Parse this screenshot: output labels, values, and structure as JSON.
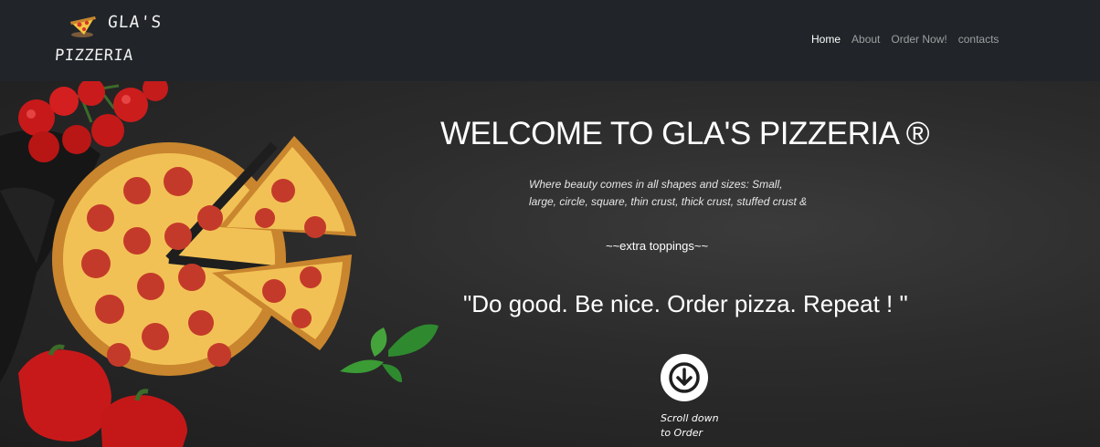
{
  "header": {
    "brand_line1": "GLA'S",
    "brand_line2": "PIZZERIA",
    "nav": [
      {
        "label": "Home",
        "active": true
      },
      {
        "label": "About"
      },
      {
        "label": "Order Now!"
      },
      {
        "label": "contacts"
      }
    ]
  },
  "hero": {
    "title": "WELCOME TO GLA'S PIZZERIA ®",
    "tagline_line1": "Where beauty comes in all shapes and sizes: Small,",
    "tagline_line2": "large, circle, square, thin crust, thick crust, stuffed crust &",
    "extra": "~~extra toppings~~",
    "quote": "\"Do good. Be nice. Order pizza. Repeat ! \"",
    "scroll_line1": "Scroll down",
    "scroll_line2": "to Order"
  },
  "icons": {
    "logo": "pizza-slice-icon",
    "scroll": "arrow-down-circle-icon"
  },
  "colors": {
    "navbar": "#212529",
    "hero_bg": "#2c2c2c",
    "text": "#ffffff"
  }
}
